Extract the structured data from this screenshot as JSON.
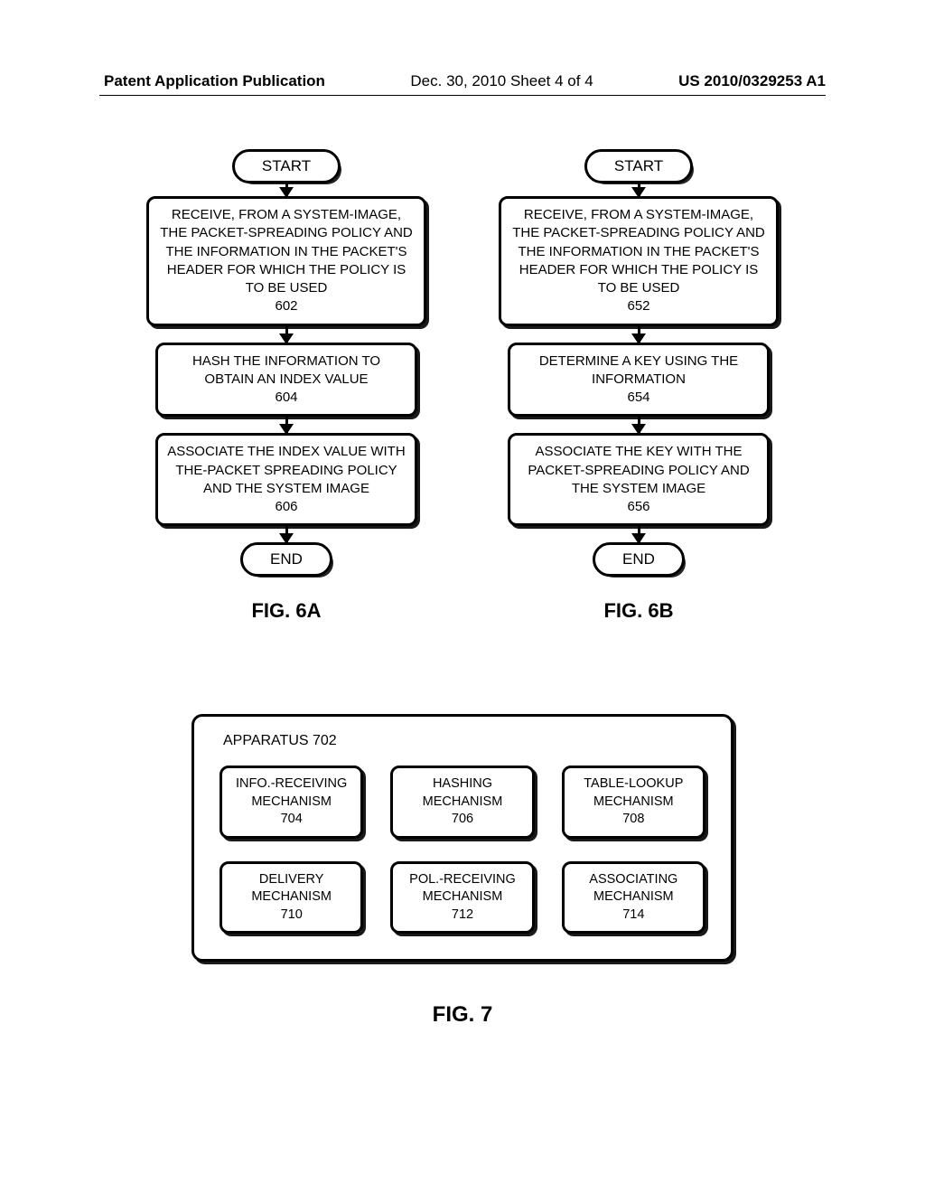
{
  "header": {
    "left": "Patent Application Publication",
    "center": "Dec. 30, 2010  Sheet 4 of 4",
    "right": "US 2010/0329253 A1"
  },
  "fig6a": {
    "start": "START",
    "step1": "RECEIVE, FROM A SYSTEM-IMAGE, THE PACKET-SPREADING POLICY AND THE INFORMATION IN THE PACKET'S HEADER FOR WHICH THE POLICY IS TO BE USED",
    "step1_num": "602",
    "step2": "HASH THE INFORMATION TO OBTAIN AN INDEX VALUE",
    "step2_num": "604",
    "step3": "ASSOCIATE THE INDEX VALUE WITH THE-PACKET SPREADING POLICY AND THE SYSTEM IMAGE",
    "step3_num": "606",
    "end": "END",
    "label": "FIG. 6A"
  },
  "fig6b": {
    "start": "START",
    "step1": "RECEIVE, FROM A SYSTEM-IMAGE, THE PACKET-SPREADING POLICY AND THE INFORMATION IN THE PACKET'S HEADER FOR WHICH THE POLICY IS TO BE USED",
    "step1_num": "652",
    "step2": "DETERMINE A KEY USING THE INFORMATION",
    "step2_num": "654",
    "step3": "ASSOCIATE THE KEY WITH THE PACKET-SPREADING POLICY AND THE SYSTEM IMAGE",
    "step3_num": "656",
    "end": "END",
    "label": "FIG. 6B"
  },
  "fig7": {
    "title": "APPARATUS 702",
    "boxes": [
      {
        "line1": "INFO.-RECEIVING",
        "line2": "MECHANISM",
        "num": "704"
      },
      {
        "line1": "HASHING",
        "line2": "MECHANISM",
        "num": "706"
      },
      {
        "line1": "TABLE-LOOKUP",
        "line2": "MECHANISM",
        "num": "708"
      },
      {
        "line1": "DELIVERY",
        "line2": "MECHANISM",
        "num": "710"
      },
      {
        "line1": "POL.-RECEIVING",
        "line2": "MECHANISM",
        "num": "712"
      },
      {
        "line1": "ASSOCIATING",
        "line2": "MECHANISM",
        "num": "714"
      }
    ],
    "label": "FIG. 7"
  }
}
